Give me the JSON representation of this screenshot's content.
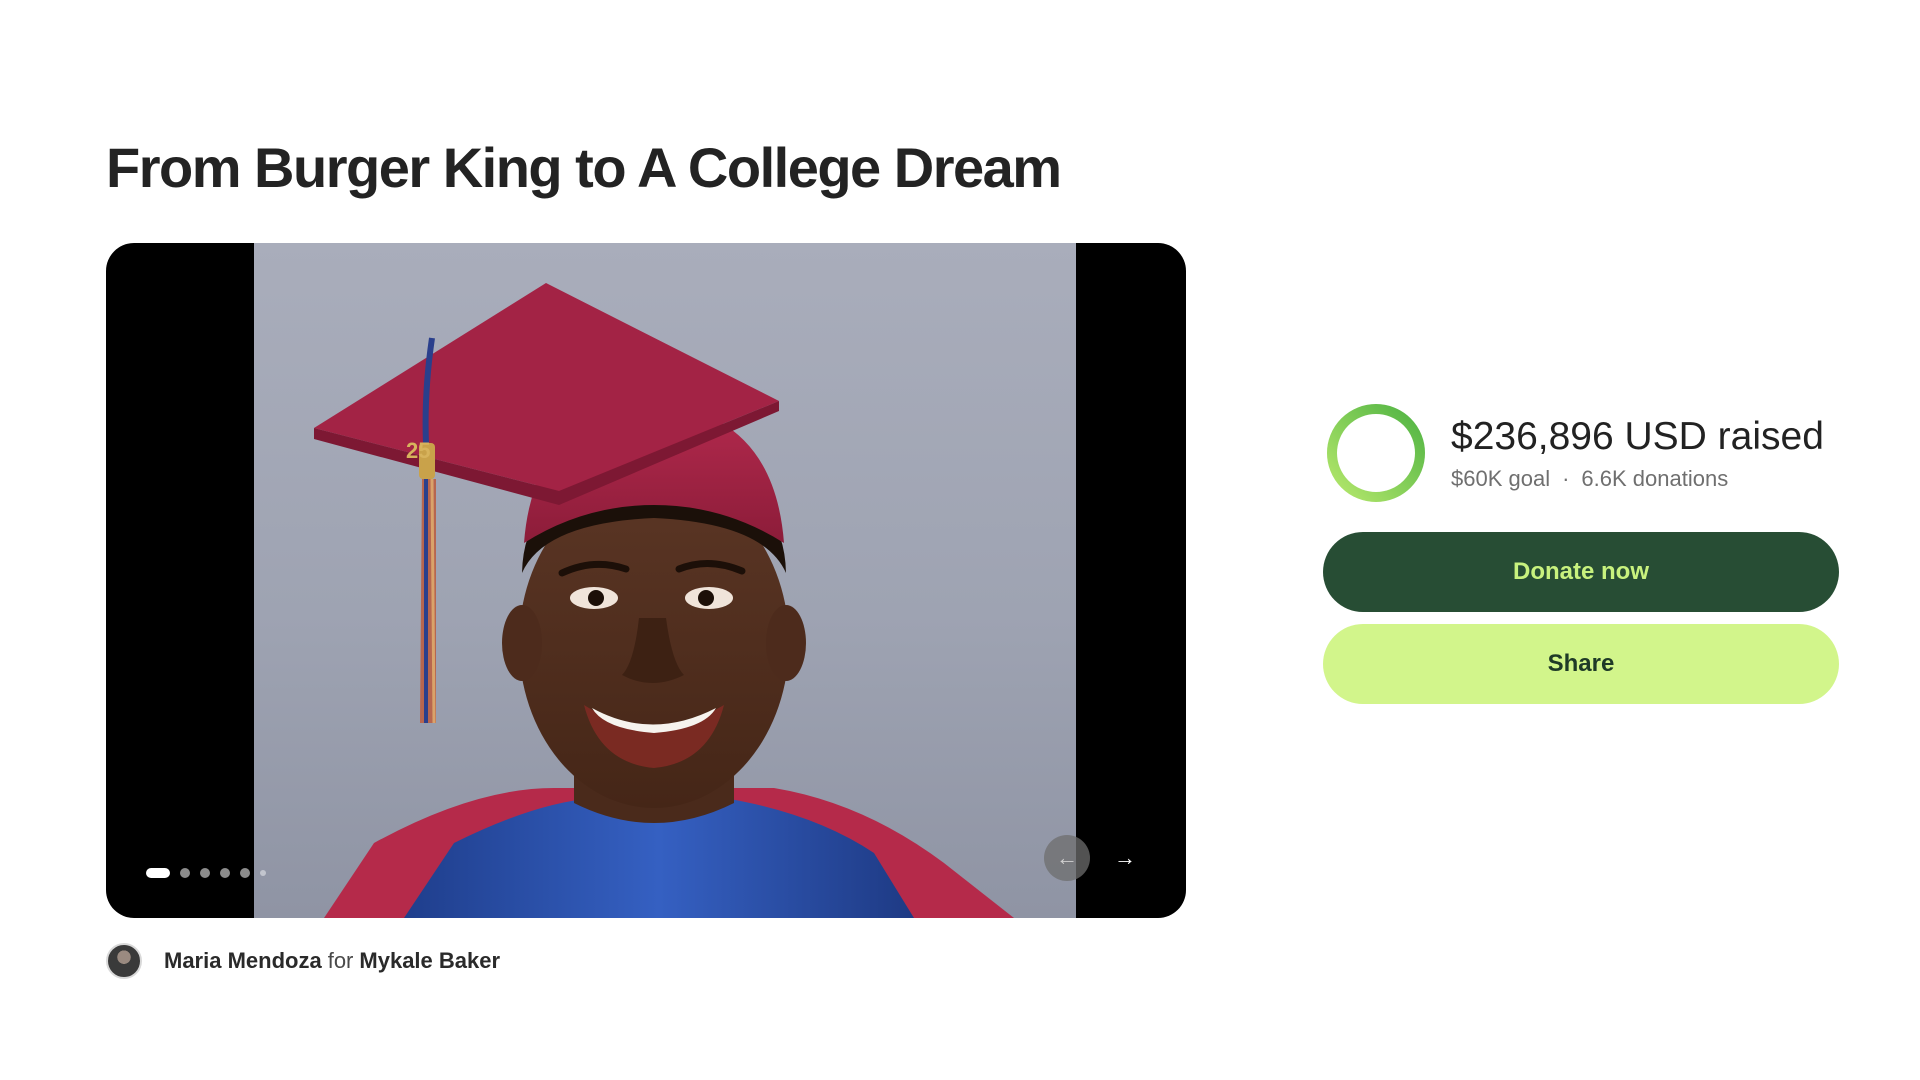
{
  "campaign": {
    "title": "From Burger King to A College Dream"
  },
  "carousel": {
    "slide_count": 6,
    "active_index": 0,
    "prev_icon": "arrow-left-icon",
    "next_icon": "arrow-right-icon"
  },
  "organizer": {
    "name": "Maria Mendoza",
    "connector": "for",
    "beneficiary": "Mykale Baker"
  },
  "progress": {
    "raised": "$236,896 USD raised",
    "goal": "$60K goal",
    "separator": "·",
    "donations": "6.6K donations",
    "fraction": 1.0
  },
  "buttons": {
    "donate": "Donate now",
    "share": "Share"
  },
  "colors": {
    "donate_bg": "#274d34",
    "donate_text": "#c8f27e",
    "share_bg": "#d2f58b",
    "ring_start": "#5fbf4a",
    "ring_end": "#b6e86c"
  }
}
